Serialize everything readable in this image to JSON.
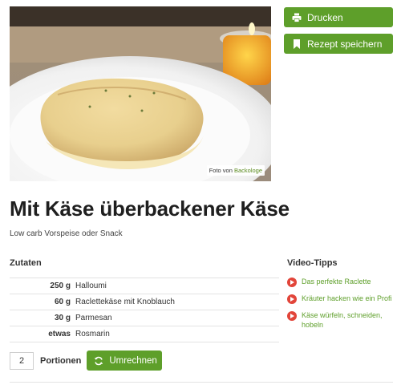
{
  "photo": {
    "credit_prefix": "Foto von",
    "credit_source": "Backologe"
  },
  "actions": {
    "print_label": "Drucken",
    "save_label": "Rezept speichern"
  },
  "recipe": {
    "title": "Mit Käse überbackener Käse",
    "subtitle": "Low carb Vorspeise oder Snack"
  },
  "ingredients": {
    "heading": "Zutaten",
    "items": [
      {
        "amount": "250 g",
        "name": "Halloumi"
      },
      {
        "amount": "60 g",
        "name": "Raclettekäse mit Knoblauch"
      },
      {
        "amount": "30 g",
        "name": "Parmesan"
      },
      {
        "amount": "etwas",
        "name": "Rosmarin"
      }
    ]
  },
  "portions": {
    "value": "2",
    "label": "Portionen",
    "recalc_label": "Umrechnen"
  },
  "videos": {
    "heading": "Video-Tipps",
    "items": [
      {
        "label": "Das perfekte Raclette"
      },
      {
        "label": "Kräuter hacken wie ein Profi"
      },
      {
        "label": "Käse würfeln, schneiden, hobeln"
      }
    ]
  },
  "colors": {
    "accent_green": "#5e9f2a",
    "play_red": "#e2453a"
  }
}
